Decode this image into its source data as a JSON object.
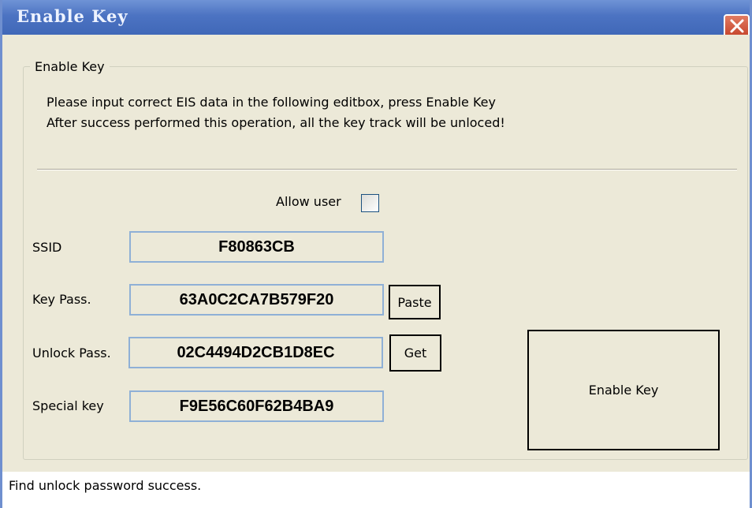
{
  "window": {
    "title": "Enable Key",
    "close_icon": "close-icon"
  },
  "group": {
    "legend": "Enable Key",
    "message_line1": "Please input correct EIS data in the following editbox, press Enable Key",
    "message_line2": "After success performed this operation, all the key track will be unloced!"
  },
  "allow_user": {
    "label": "Allow user",
    "checked": false
  },
  "fields": {
    "ssid": {
      "label": "SSID",
      "value": "F80863CB"
    },
    "key_pass": {
      "label": "Key Pass.",
      "value": "63A0C2CA7B579F20"
    },
    "unlock_pass": {
      "label": "Unlock Pass.",
      "value": "02C4494D2CB1D8EC"
    },
    "special_key": {
      "label": "Special key",
      "value": "F9E56C60F62B4BA9"
    }
  },
  "buttons": {
    "paste": "Paste",
    "get": "Get",
    "enable_key": "Enable Key"
  },
  "status": {
    "text": "Find unlock password success."
  },
  "colors": {
    "titlebar": "#4c73c2",
    "dialog_bg": "#ece9d8",
    "close_button": "#d0573d",
    "field_border": "#8fb0d6"
  }
}
